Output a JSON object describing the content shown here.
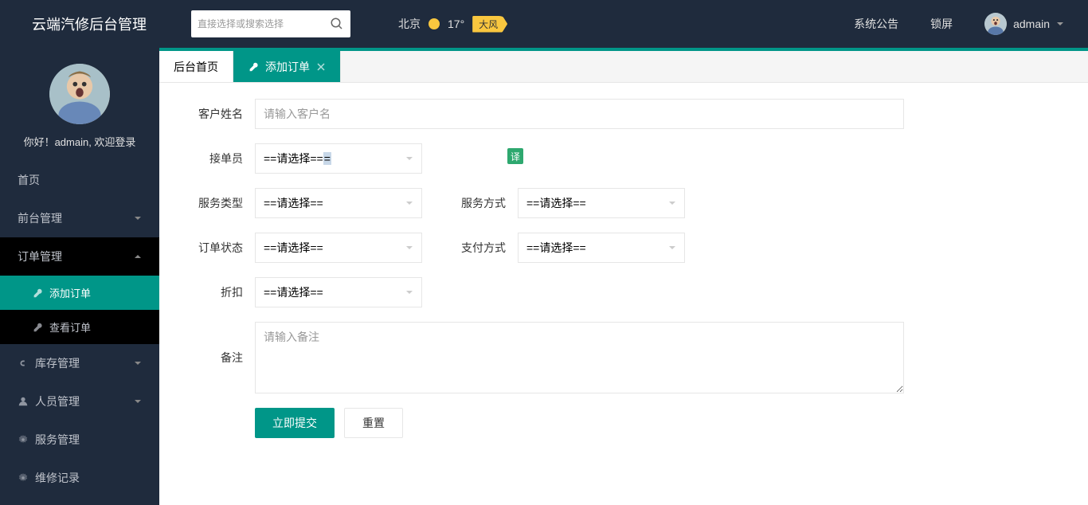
{
  "header": {
    "logo": "云端汽修后台管理",
    "search_placeholder": "直接选择或搜索选择",
    "weather": {
      "city": "北京",
      "temp": "17°",
      "wind": "大风"
    },
    "links": {
      "announcement": "系统公告",
      "lock": "锁屏"
    },
    "user": "admain"
  },
  "sidebar": {
    "welcome": "你好！admain, 欢迎登录",
    "items": [
      {
        "label": "首页",
        "type": "simple"
      },
      {
        "label": "前台管理",
        "type": "expandable"
      },
      {
        "label": "订单管理",
        "type": "expanded",
        "children": [
          {
            "label": "添加订单",
            "active": true
          },
          {
            "label": "查看订单",
            "active": false
          }
        ]
      },
      {
        "label": "库存管理",
        "type": "expandable",
        "icon": "link"
      },
      {
        "label": "人员管理",
        "type": "expandable",
        "icon": "people"
      },
      {
        "label": "服务管理",
        "type": "simple",
        "icon": "gear"
      },
      {
        "label": "维修记录",
        "type": "simple",
        "icon": "gear"
      }
    ]
  },
  "tabs": [
    {
      "label": "后台首页",
      "active": false,
      "closable": false
    },
    {
      "label": "添加订单",
      "active": true,
      "closable": true
    }
  ],
  "form": {
    "customer_label": "客户姓名",
    "customer_placeholder": "请输入客户名",
    "receiver_label": "接单员",
    "service_type_label": "服务类型",
    "service_method_label": "服务方式",
    "order_status_label": "订单状态",
    "payment_label": "支付方式",
    "discount_label": "折扣",
    "remark_label": "备注",
    "remark_placeholder": "请输入备注",
    "select_default": "==请选择==",
    "submit": "立即提交",
    "reset": "重置",
    "translate_badge": "译"
  }
}
